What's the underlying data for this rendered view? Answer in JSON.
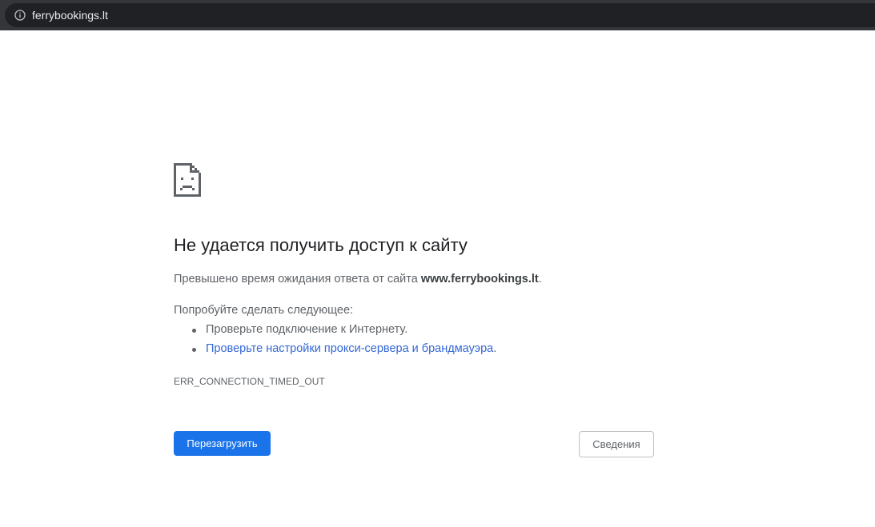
{
  "browser": {
    "url": "ferrybookings.lt",
    "site_info_icon": "info-icon"
  },
  "error_page": {
    "icon": "sad-page-icon",
    "title": "Не удается получить доступ к сайту",
    "description_prefix": "Превышено время ожидания ответа от сайта ",
    "description_host": "www.ferrybookings.lt",
    "description_suffix": ".",
    "try_label": "Попробуйте сделать следующее:",
    "suggestions": [
      {
        "text": "Проверьте подключение к Интернету."
      },
      {
        "link_text": "Проверьте настройки прокси-сервера и брандмауэра",
        "suffix": "."
      }
    ],
    "error_code": "ERR_CONNECTION_TIMED_OUT",
    "reload_label": "Перезагрузить",
    "details_label": "Сведения"
  },
  "colors": {
    "reload_button": "#1a73e8",
    "link": "#3367d6",
    "toolbar": "#35363a"
  }
}
